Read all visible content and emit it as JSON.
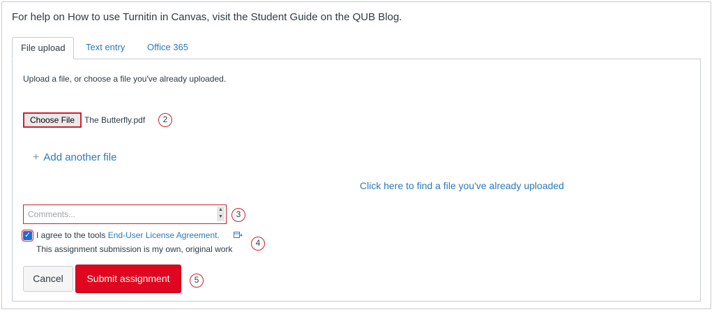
{
  "help_text": "For help on How to use Turnitin in Canvas, visit the Student Guide on the QUB Blog.",
  "tabs": [
    {
      "label": "File upload",
      "active": true
    },
    {
      "label": "Text entry",
      "active": false
    },
    {
      "label": "Office 365",
      "active": false
    }
  ],
  "upload": {
    "hint": "Upload a file, or choose a file you've already uploaded.",
    "choose_label": "Choose File",
    "filename": "The Butterfly.pdf",
    "add_another": "Add another file",
    "add_icon": "plus-icon",
    "find_uploaded": "Click here to find a file you've already uploaded"
  },
  "comments": {
    "placeholder": "Comments..."
  },
  "agreement": {
    "checked": true,
    "text_prefix": "I agree to the tools ",
    "link_text": "End-User License Agreement.",
    "link_icon": "external-link-icon",
    "statement": "This assignment submission is my own, original work"
  },
  "buttons": {
    "cancel": "Cancel",
    "submit": "Submit assignment"
  },
  "callouts": [
    "2",
    "3",
    "4",
    "5"
  ],
  "colors": {
    "link": "#2b7abc",
    "submit": "#e0061f",
    "annotation_red": "#d0202e",
    "checkbox": "#1a6cdb"
  }
}
